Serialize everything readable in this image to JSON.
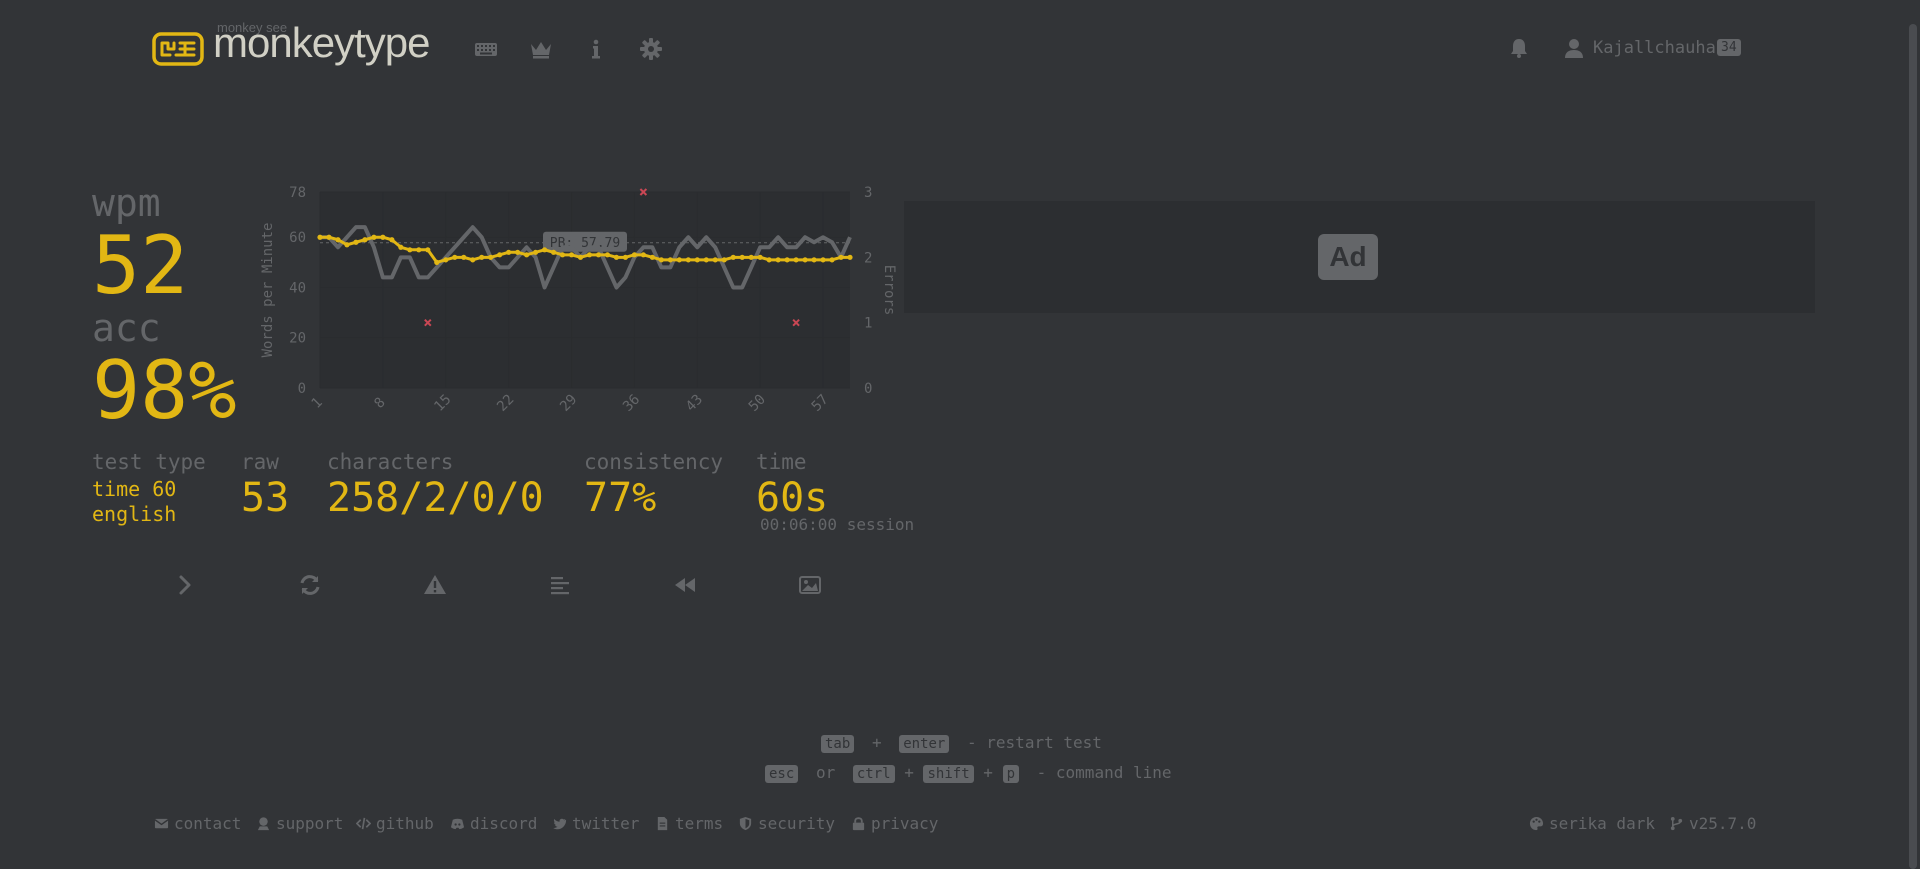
{
  "header": {
    "logo_top": "monkey see",
    "logo_text": "monkeytype",
    "nav": [
      "keyboard-icon",
      "crown-icon",
      "info-icon",
      "gear-icon"
    ],
    "username": "Kajallchauhan",
    "level": "34"
  },
  "results": {
    "wpm_label": "wpm",
    "wpm_value": "52",
    "acc_label": "acc",
    "acc_value": "98%",
    "test_type_label": "test type",
    "test_type_line1": "time 60",
    "test_type_line2": "english",
    "raw_label": "raw",
    "raw_value": "53",
    "characters_label": "characters",
    "characters_value": "258/2/0/0",
    "consistency_label": "consistency",
    "consistency_value": "77%",
    "time_label": "time",
    "time_value": "60s",
    "session": "00:06:00 session"
  },
  "chart_data": {
    "type": "line",
    "ylabel": "Words per Minute",
    "y2label": "Errors",
    "ylim": [
      0,
      78
    ],
    "y2lim": [
      0,
      3
    ],
    "yticks": [
      0,
      20,
      40,
      60,
      78
    ],
    "y2ticks": [
      0,
      1,
      2,
      3
    ],
    "xticks": [
      1,
      8,
      15,
      22,
      29,
      36,
      43,
      50,
      57
    ],
    "pb_label": "PB: 57.79",
    "pb_value": 57.79,
    "series": [
      {
        "name": "wpm",
        "color": "#e2b714",
        "x": [
          1,
          2,
          3,
          4,
          5,
          6,
          7,
          8,
          9,
          10,
          11,
          12,
          13,
          14,
          15,
          16,
          17,
          18,
          19,
          20,
          21,
          22,
          23,
          24,
          25,
          26,
          27,
          28,
          29,
          30,
          31,
          32,
          33,
          34,
          35,
          36,
          37,
          38,
          39,
          40,
          41,
          42,
          43,
          44,
          45,
          46,
          47,
          48,
          49,
          50,
          51,
          52,
          53,
          54,
          55,
          56,
          57,
          58,
          59,
          60
        ],
        "values": [
          60,
          60,
          59,
          57,
          58,
          59,
          60,
          60,
          59,
          56,
          55,
          55,
          55,
          50,
          51,
          52,
          52,
          51,
          52,
          52,
          53,
          54,
          54,
          53,
          54,
          55,
          54,
          53,
          53,
          52,
          53,
          53,
          53,
          52,
          52,
          53,
          53,
          52,
          51,
          51,
          51,
          51,
          51,
          51,
          51,
          51,
          52,
          52,
          52,
          52,
          51,
          51,
          51,
          51,
          51,
          51,
          51,
          51,
          52,
          52
        ]
      },
      {
        "name": "raw",
        "color": "#646669",
        "x": [
          1,
          2,
          3,
          4,
          5,
          6,
          7,
          8,
          9,
          10,
          11,
          12,
          13,
          14,
          15,
          16,
          17,
          18,
          19,
          20,
          21,
          22,
          23,
          24,
          25,
          26,
          27,
          28,
          29,
          30,
          31,
          32,
          33,
          34,
          35,
          36,
          37,
          38,
          39,
          40,
          41,
          42,
          43,
          44,
          45,
          46,
          47,
          48,
          49,
          50,
          51,
          52,
          53,
          54,
          55,
          56,
          57,
          58,
          59,
          60
        ],
        "values": [
          60,
          60,
          56,
          60,
          64,
          64,
          56,
          44,
          44,
          52,
          52,
          44,
          44,
          48,
          52,
          56,
          60,
          64,
          60,
          52,
          48,
          48,
          52,
          56,
          52,
          40,
          48,
          56,
          56,
          52,
          56,
          56,
          48,
          40,
          44,
          52,
          56,
          56,
          48,
          48,
          56,
          60,
          56,
          60,
          56,
          48,
          40,
          40,
          48,
          56,
          56,
          60,
          56,
          56,
          60,
          58,
          60,
          58,
          52,
          60
        ]
      },
      {
        "name": "errors",
        "color": "#ca4754",
        "type": "scatter",
        "x": [
          13,
          37,
          54
        ],
        "values": [
          1,
          3,
          1
        ]
      }
    ]
  },
  "ad": {
    "label": "Ad"
  },
  "actions": [
    "next-test",
    "restart-test",
    "report-issue",
    "words-history",
    "watch-replay",
    "save-screenshot"
  ],
  "hints": {
    "line1_key1": "tab",
    "line1_plus": "+",
    "line1_key2": "enter",
    "line1_text": "- restart test",
    "line2_key1": "esc",
    "line2_or": "or",
    "line2_key2": "ctrl",
    "line2_plus1": "+",
    "line2_key3": "shift",
    "line2_plus2": "+",
    "line2_key4": "p",
    "line2_text": "- command line"
  },
  "footer": {
    "contact": "contact",
    "support": "support",
    "github": "github",
    "discord": "discord",
    "twitter": "twitter",
    "terms": "terms",
    "security": "security",
    "privacy": "privacy",
    "theme": "serika dark",
    "version": "v25.7.0"
  },
  "colors": {
    "bg": "#323437",
    "main": "#e2b714",
    "sub": "#646669",
    "text": "#d1d0c5",
    "error": "#ca4754"
  }
}
